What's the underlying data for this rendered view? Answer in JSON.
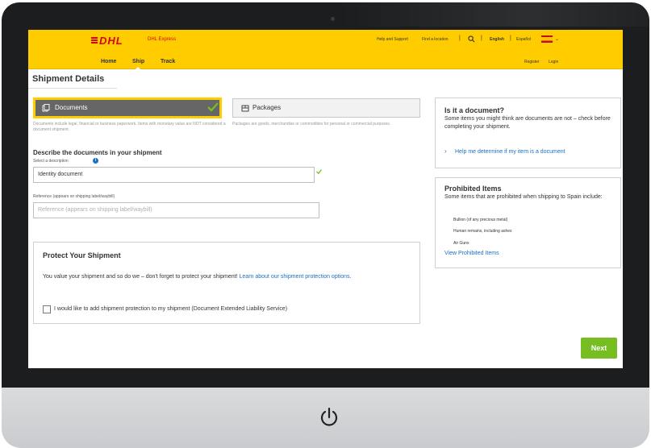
{
  "header": {
    "logo_text": "DHL",
    "logo_sub": "DHL Express",
    "util_links": [
      "Help and Support",
      "Find a location"
    ],
    "lang_active": "English",
    "lang_other": "Español",
    "nav": [
      "Home",
      "Ship",
      "Track"
    ],
    "account": [
      "Register",
      "Login"
    ],
    "brand_color": "#ffcc00",
    "brand_red": "#d40511"
  },
  "main": {
    "page_title": "Shipment Details",
    "options": [
      {
        "label": "Documents",
        "note": "Documents include legal, financial or business paperwork. Items with monetary value are NOT considered a document shipment.",
        "selected": true
      },
      {
        "label": "Packages",
        "note": "Packages are goods, merchandise or commodities for personal or commercial purposes.",
        "selected": false
      }
    ],
    "describe_heading": "Describe the documents in your shipment",
    "select_label": "Select a description",
    "description_value": "Identity document",
    "reference_label": "Reference (appears on shipping label/waybill)",
    "reference_placeholder": "Reference (appears on shipping label/waybill)"
  },
  "protect": {
    "title": "Protect Your Shipment",
    "text": "You value your shipment and so do we – don't forget to protect your shipment!",
    "link": "Learn about our shipment protection options.",
    "checkbox_label": "I would like to add shipment protection to my shipment (Document Extended Liability Service)"
  },
  "sidebar": {
    "doc_title": "Is it a document?",
    "doc_text": "Some items you might think are documents are not – check before completing your shipment.",
    "doc_link": "Help me determine if my item is a document",
    "prohibited_title": "Prohibited Items",
    "prohibited_text": "Some items that are prohibited when shipping to Spain include:",
    "prohibited_items": [
      "Bullion (of any precious metal)",
      "Human remains, including ashes",
      "Air Guns"
    ],
    "prohibited_link": "View Prohibited Items"
  },
  "actions": {
    "next_label": "Next",
    "accent": "#76bd22"
  }
}
